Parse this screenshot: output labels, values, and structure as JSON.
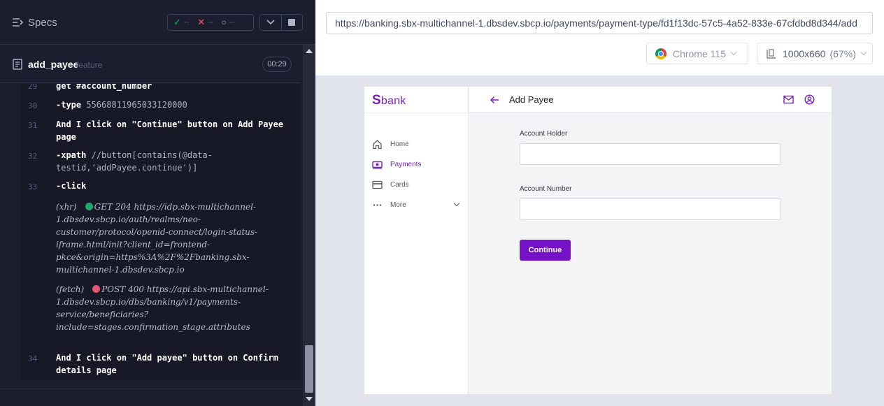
{
  "runner": {
    "specs_label": "Specs",
    "stats": {
      "passed": "--",
      "failed": "--",
      "pending": "--"
    },
    "spec_name": "add_payee",
    "spec_ext": "feature",
    "timer": "00:29"
  },
  "log": [
    {
      "line": "29",
      "text": "get  #account_number"
    },
    {
      "line": "30",
      "keyword": "-type",
      "arg": "55668811965033120000"
    },
    {
      "line": "31",
      "text": "And  I click on \"Continue\" button on Add Payee page"
    },
    {
      "line": "32",
      "keyword": "-xpath",
      "arg": "//button[contains(@data-testid,'addPayee.continue')]"
    },
    {
      "line": "33",
      "keyword": "-click",
      "arg": ""
    }
  ],
  "requests": [
    {
      "kind": "(xhr)",
      "status_color": "#1fa971",
      "text": "GET 204 https://idp.sbx-multichannel-1.dbsdev.sbcp.io/auth/realms/neo-customer/protocol/openid-connect/login-status-iframe.html/init?client_id=frontend-pkce&origin=https%3A%2F%2Fbanking.sbx-multichannel-1.dbsdev.sbcp.io"
    },
    {
      "kind": "(fetch)",
      "status_color": "#e45770",
      "text": "POST 400 https://api.sbx-multichannel-1.dbsdev.sbcp.io/dbs/banking/v1/payments-service/beneficiaries?include=stages.confirmation_stage.attributes"
    }
  ],
  "log_tail": {
    "line": "34",
    "text": "And  I click on \"Add payee\" button on Confirm details page"
  },
  "browser": {
    "url": "https://banking.sbx-multichannel-1.dbsdev.sbcp.io/payments/payment-type/fd1f13dc-57c5-4a52-833e-67cfdbd8d344/add",
    "browser_name": "Chrome 115",
    "viewport": "1000x660",
    "scale": "(67%)"
  },
  "app": {
    "logo_s": "S",
    "logo_rest": "bank",
    "nav": [
      {
        "label": "Home",
        "icon": "home-icon"
      },
      {
        "label": "Payments",
        "icon": "payments-icon",
        "active": true
      },
      {
        "label": "Cards",
        "icon": "card-icon"
      },
      {
        "label": "More",
        "icon": "more-icon"
      }
    ],
    "title": "Add Payee",
    "account_holder_label": "Account Holder",
    "account_number_label": "Account Number",
    "continue_label": "Continue"
  },
  "colors": {
    "brand_purple": "#7511c7",
    "runner_bg": "#1b1e2e",
    "pass": "#1fa971",
    "fail": "#e45770"
  }
}
